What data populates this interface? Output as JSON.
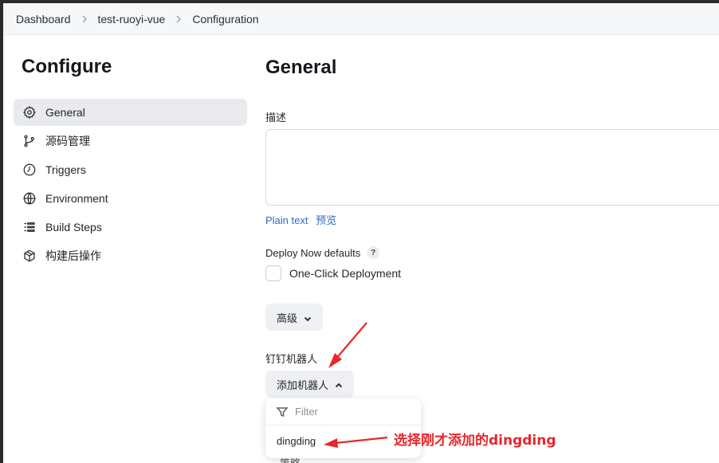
{
  "breadcrumb": {
    "items": [
      "Dashboard",
      "test-ruoyi-vue",
      "Configuration"
    ]
  },
  "sidebar": {
    "title": "Configure",
    "items": [
      {
        "label": "General",
        "icon": "gear-icon"
      },
      {
        "label": "源码管理",
        "icon": "branch-icon"
      },
      {
        "label": "Triggers",
        "icon": "clock-icon"
      },
      {
        "label": "Environment",
        "icon": "globe-icon"
      },
      {
        "label": "Build Steps",
        "icon": "list-icon"
      },
      {
        "label": "构建后操作",
        "icon": "package-icon"
      }
    ]
  },
  "main": {
    "title": "General",
    "description_label": "描述",
    "description_value": "",
    "plain_text_link": "Plain text",
    "preview_link": "预览",
    "deploy_label": "Deploy Now defaults",
    "help_icon": "?",
    "one_click_label": "One-Click Deployment",
    "advanced_button": "高级",
    "dingtalk_label": "钉钉机器人",
    "add_robot_button": "添加机器人",
    "dropdown": {
      "filter_placeholder": "Filter",
      "items": [
        "dingding"
      ]
    },
    "partial_text": "策略"
  },
  "annotation": {
    "text": "选择刚才添加的dingding",
    "color": "#e8272a"
  }
}
